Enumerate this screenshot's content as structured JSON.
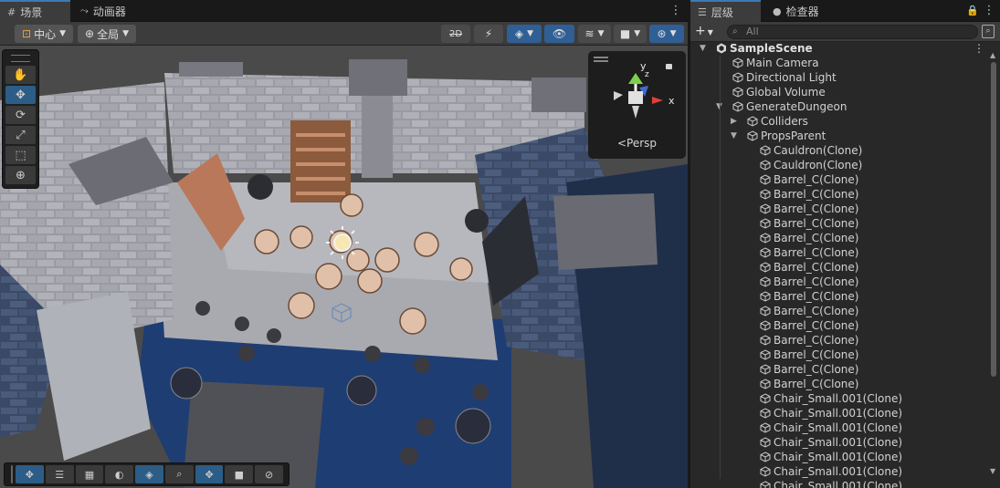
{
  "scene_panel": {
    "tabs": [
      {
        "label": "场景",
        "icon": "grid-icon",
        "active": true
      },
      {
        "label": "动画器",
        "icon": "animator-icon",
        "active": false
      }
    ],
    "toolbar": {
      "pivot_label": "中心",
      "space_label": "全局"
    },
    "gizmo": {
      "axis_x": "x",
      "axis_y": "y",
      "axis_z": "z",
      "projection_label": "Persp"
    }
  },
  "hierarchy_panel": {
    "tabs": [
      {
        "label": "层级",
        "icon": "list-icon",
        "active": true
      },
      {
        "label": "检查器",
        "icon": "info-icon",
        "active": false
      }
    ],
    "search_placeholder": "All",
    "rows": [
      {
        "label": "SampleScene",
        "depth": 0,
        "expanded": true,
        "kind": "scene"
      },
      {
        "label": "Main Camera",
        "depth": 1,
        "kind": "object"
      },
      {
        "label": "Directional Light",
        "depth": 1,
        "kind": "object"
      },
      {
        "label": "Global Volume",
        "depth": 1,
        "kind": "object"
      },
      {
        "label": "GenerateDungeon",
        "depth": 1,
        "expanded": true,
        "kind": "object"
      },
      {
        "label": "Colliders",
        "depth": 2,
        "expanded": false,
        "kind": "object"
      },
      {
        "label": "PropsParent",
        "depth": 2,
        "expanded": true,
        "kind": "object"
      },
      {
        "label": "Cauldron(Clone)",
        "depth": 3,
        "kind": "object"
      },
      {
        "label": "Cauldron(Clone)",
        "depth": 3,
        "kind": "object"
      },
      {
        "label": "Barrel_C(Clone)",
        "depth": 3,
        "kind": "object"
      },
      {
        "label": "Barrel_C(Clone)",
        "depth": 3,
        "kind": "object"
      },
      {
        "label": "Barrel_C(Clone)",
        "depth": 3,
        "kind": "object"
      },
      {
        "label": "Barrel_C(Clone)",
        "depth": 3,
        "kind": "object"
      },
      {
        "label": "Barrel_C(Clone)",
        "depth": 3,
        "kind": "object"
      },
      {
        "label": "Barrel_C(Clone)",
        "depth": 3,
        "kind": "object"
      },
      {
        "label": "Barrel_C(Clone)",
        "depth": 3,
        "kind": "object"
      },
      {
        "label": "Barrel_C(Clone)",
        "depth": 3,
        "kind": "object"
      },
      {
        "label": "Barrel_C(Clone)",
        "depth": 3,
        "kind": "object"
      },
      {
        "label": "Barrel_C(Clone)",
        "depth": 3,
        "kind": "object"
      },
      {
        "label": "Barrel_C(Clone)",
        "depth": 3,
        "kind": "object"
      },
      {
        "label": "Barrel_C(Clone)",
        "depth": 3,
        "kind": "object"
      },
      {
        "label": "Barrel_C(Clone)",
        "depth": 3,
        "kind": "object"
      },
      {
        "label": "Barrel_C(Clone)",
        "depth": 3,
        "kind": "object"
      },
      {
        "label": "Barrel_C(Clone)",
        "depth": 3,
        "kind": "object"
      },
      {
        "label": "Chair_Small.001(Clone)",
        "depth": 3,
        "kind": "object"
      },
      {
        "label": "Chair_Small.001(Clone)",
        "depth": 3,
        "kind": "object"
      },
      {
        "label": "Chair_Small.001(Clone)",
        "depth": 3,
        "kind": "object"
      },
      {
        "label": "Chair_Small.001(Clone)",
        "depth": 3,
        "kind": "object"
      },
      {
        "label": "Chair_Small.001(Clone)",
        "depth": 3,
        "kind": "object"
      },
      {
        "label": "Chair_Small.001(Clone)",
        "depth": 3,
        "kind": "object"
      },
      {
        "label": "Chair_Small.001(Clone)",
        "depth": 3,
        "kind": "object"
      }
    ]
  },
  "colors": {
    "accent_blue": "#2c5d87",
    "panel_bg": "#282828",
    "tab_bar_bg": "#191919",
    "text": "#d2d2d2"
  }
}
